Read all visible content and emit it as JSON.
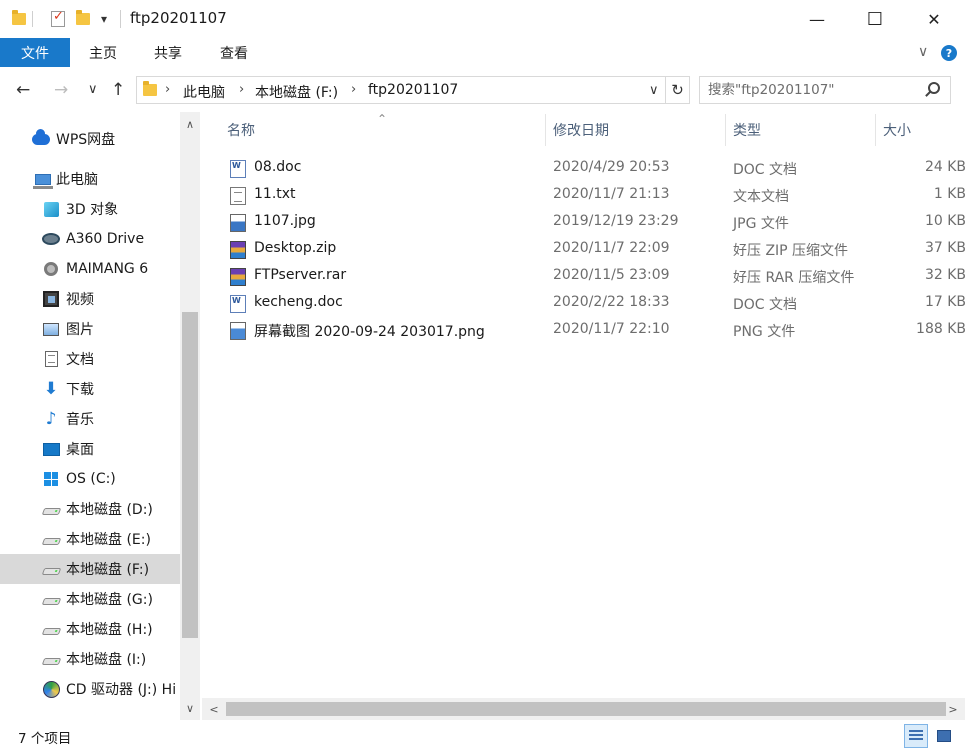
{
  "window": {
    "title": "ftp20201107",
    "minimize_glyph": "—",
    "maximize_glyph": "☐",
    "close_glyph": "✕"
  },
  "quick_access": {
    "dropdown_glyph": "▾"
  },
  "ribbon": {
    "tabs": [
      {
        "label": "文件",
        "active": true
      },
      {
        "label": "主页"
      },
      {
        "label": "共享"
      },
      {
        "label": "查看"
      }
    ],
    "expand_glyph": "∨",
    "help_glyph": "?"
  },
  "nav": {
    "back_glyph": "←",
    "forward_glyph": "→",
    "recent_glyph": "∨",
    "up_glyph": "↑",
    "refresh_glyph": "↻",
    "addr_dropdown_glyph": "∨"
  },
  "address": {
    "crumbs": [
      "此电脑",
      "本地磁盘 (F:)",
      "ftp20201107"
    ],
    "sep_glyph": "›"
  },
  "search": {
    "placeholder": "搜索\"ftp20201107\""
  },
  "sidebar": {
    "items": [
      {
        "label": "WPS网盘",
        "icon": "cloud-icon"
      },
      {
        "label": "此电脑",
        "icon": "this-pc-icon"
      },
      {
        "label": "3D 对象",
        "icon": "3d-objects-icon"
      },
      {
        "label": "A360 Drive",
        "icon": "a360-drive-icon"
      },
      {
        "label": "MAIMANG 6",
        "icon": "webcam-icon"
      },
      {
        "label": "视频",
        "icon": "video-icon"
      },
      {
        "label": "图片",
        "icon": "pictures-icon"
      },
      {
        "label": "文档",
        "icon": "documents-icon"
      },
      {
        "label": "下载",
        "icon": "download-icon"
      },
      {
        "label": "音乐",
        "icon": "music-icon"
      },
      {
        "label": "桌面",
        "icon": "desktop-icon"
      },
      {
        "label": "OS (C:)",
        "icon": "windows-drive-icon"
      },
      {
        "label": "本地磁盘 (D:)",
        "icon": "drive-icon"
      },
      {
        "label": "本地磁盘 (E:)",
        "icon": "drive-icon"
      },
      {
        "label": "本地磁盘 (F:)",
        "icon": "drive-icon",
        "selected": true
      },
      {
        "label": "本地磁盘 (G:)",
        "icon": "drive-icon"
      },
      {
        "label": "本地磁盘 (H:)",
        "icon": "drive-icon"
      },
      {
        "label": "本地磁盘 (I:)",
        "icon": "drive-icon"
      },
      {
        "label": "CD 驱动器 (J:) Hi",
        "icon": "cd-drive-icon"
      }
    ],
    "scroll_up_glyph": "∧",
    "scroll_down_glyph": "∨"
  },
  "columns": {
    "name": "名称",
    "date": "修改日期",
    "type": "类型",
    "size": "大小",
    "sort_glyph": "⌃"
  },
  "files": [
    {
      "name": "08.doc",
      "date": "2020/4/29 20:53",
      "type": "DOC 文档",
      "size": "24 KB",
      "icon": "doc"
    },
    {
      "name": "11.txt",
      "date": "2020/11/7 21:13",
      "type": "文本文档",
      "size": "1 KB",
      "icon": "txt"
    },
    {
      "name": "1107.jpg",
      "date": "2019/12/19 23:29",
      "type": "JPG 文件",
      "size": "10 KB",
      "icon": "jpg"
    },
    {
      "name": "Desktop.zip",
      "date": "2020/11/7 22:09",
      "type": "好压 ZIP 压缩文件",
      "size": "37 KB",
      "icon": "zip"
    },
    {
      "name": "FTPserver.rar",
      "date": "2020/11/5 23:09",
      "type": "好压 RAR 压缩文件",
      "size": "32 KB",
      "icon": "zip"
    },
    {
      "name": "kecheng.doc",
      "date": "2020/2/22 18:33",
      "type": "DOC 文档",
      "size": "17 KB",
      "icon": "doc"
    },
    {
      "name": "屏幕截图 2020-09-24 203017.png",
      "date": "2020/11/7 22:10",
      "type": "PNG 文件",
      "size": "188 KB",
      "icon": "png"
    }
  ],
  "hscroll": {
    "left_glyph": "<",
    "right_glyph": ">"
  },
  "status": {
    "item_count": "7 个项目"
  },
  "colors": {
    "accent": "#1979ca",
    "selected_bg": "#d9d9d9"
  }
}
